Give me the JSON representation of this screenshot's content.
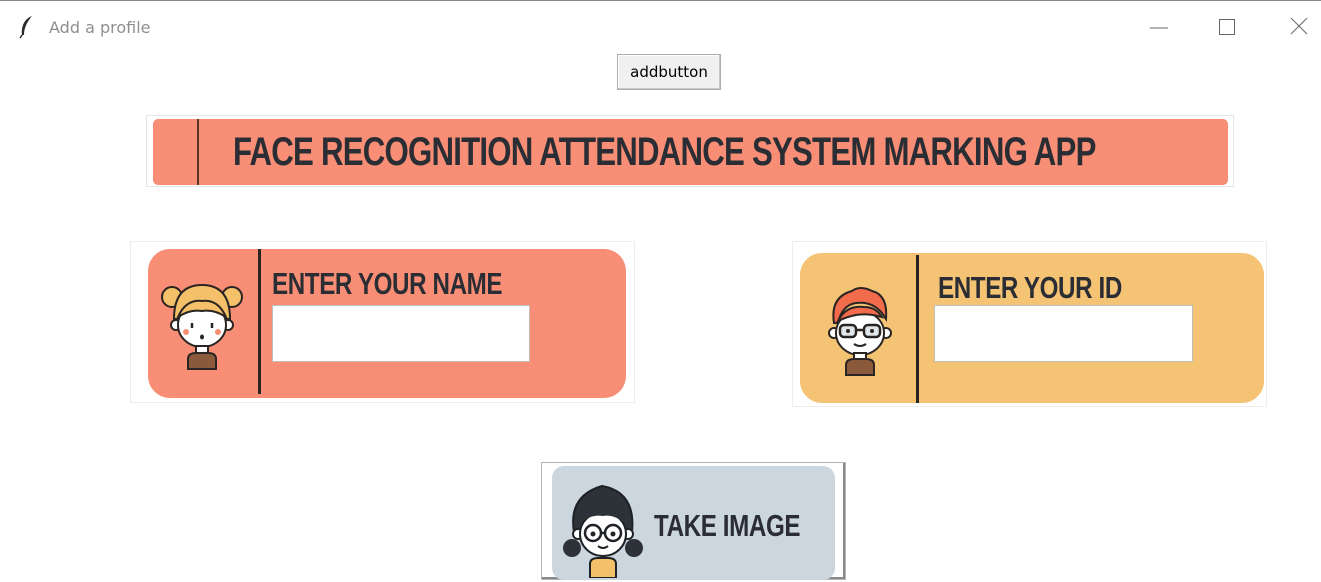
{
  "window": {
    "title": "Add a profile",
    "app_icon": "feather-icon",
    "controls": [
      "minimize-icon",
      "maximize-icon",
      "close-icon"
    ]
  },
  "toolbar": {
    "add_button_label": "addbutton"
  },
  "banner": {
    "title": "FACE RECOGNITION ATTENDANCE SYSTEM MARKING APP"
  },
  "name_card": {
    "label": "ENTER YOUR NAME",
    "value": "",
    "avatar": "girl-avatar-icon"
  },
  "id_card": {
    "label": "ENTER YOUR ID",
    "value": "",
    "avatar": "boy-glasses-avatar-icon"
  },
  "take_image": {
    "label": "TAKE IMAGE",
    "avatar": "girl-glasses-avatar-icon"
  },
  "colors": {
    "salmon": "#f88e75",
    "mustard": "#f4c374",
    "slate": "#ccd6de",
    "text_dark": "#2a2d33"
  }
}
